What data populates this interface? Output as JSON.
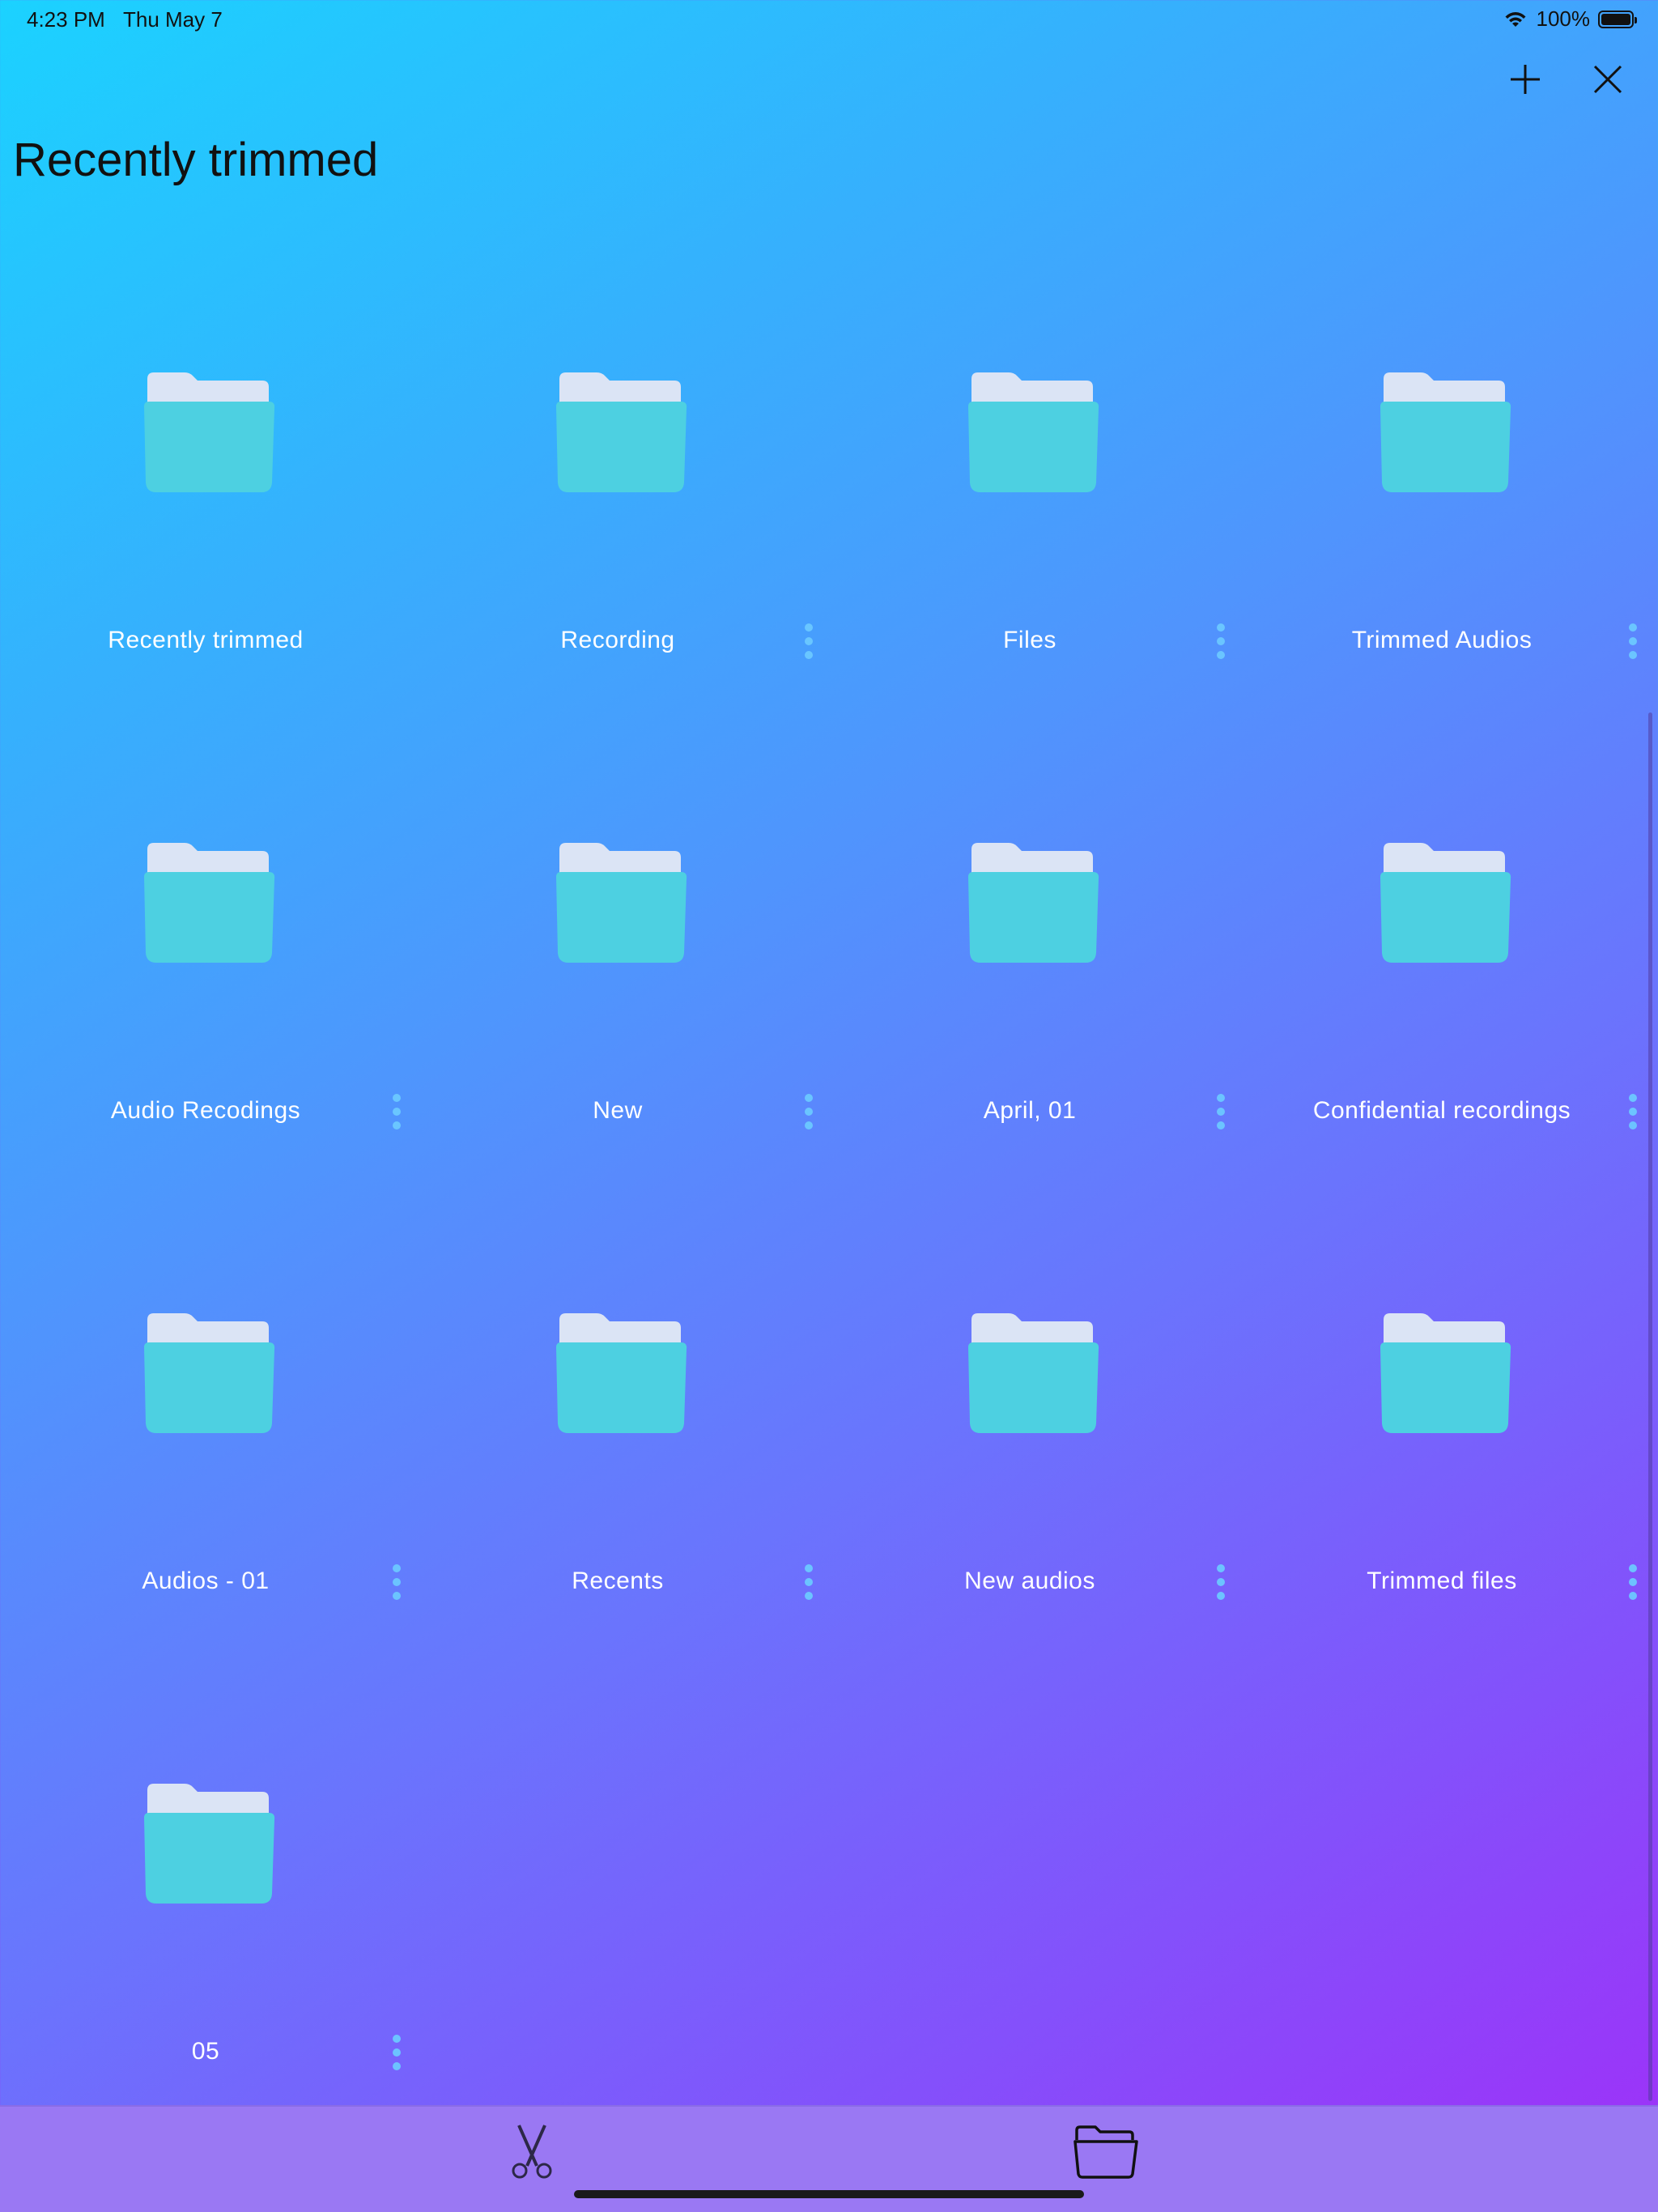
{
  "status_bar": {
    "time": "4:23 PM",
    "date": "Thu May 7",
    "battery": "100%"
  },
  "header": {
    "title": "Recently trimmed",
    "add_icon": "plus-icon",
    "close_icon": "close-icon"
  },
  "folders": [
    {
      "label": "Recently trimmed",
      "has_menu": false
    },
    {
      "label": "Recording",
      "has_menu": true
    },
    {
      "label": "Files",
      "has_menu": true
    },
    {
      "label": "Trimmed Audios",
      "has_menu": true
    },
    {
      "label": "Audio Recodings",
      "has_menu": true
    },
    {
      "label": "New",
      "has_menu": true
    },
    {
      "label": "April, 01",
      "has_menu": true
    },
    {
      "label": "Confidential recordings",
      "has_menu": true
    },
    {
      "label": "Audios - 01",
      "has_menu": true
    },
    {
      "label": "Recents",
      "has_menu": true
    },
    {
      "label": "New audios",
      "has_menu": true
    },
    {
      "label": "Trimmed files",
      "has_menu": true
    },
    {
      "label": "05",
      "has_menu": true
    }
  ],
  "tab_bar": {
    "tabs": [
      {
        "icon": "scissors-icon"
      },
      {
        "icon": "folder-open-icon"
      }
    ]
  },
  "colors": {
    "folder_front": "#4dd0e1",
    "folder_back": "#dbe4f5",
    "menu_dots": "#6cc8ff",
    "tab_bar": "#9a78f3"
  }
}
